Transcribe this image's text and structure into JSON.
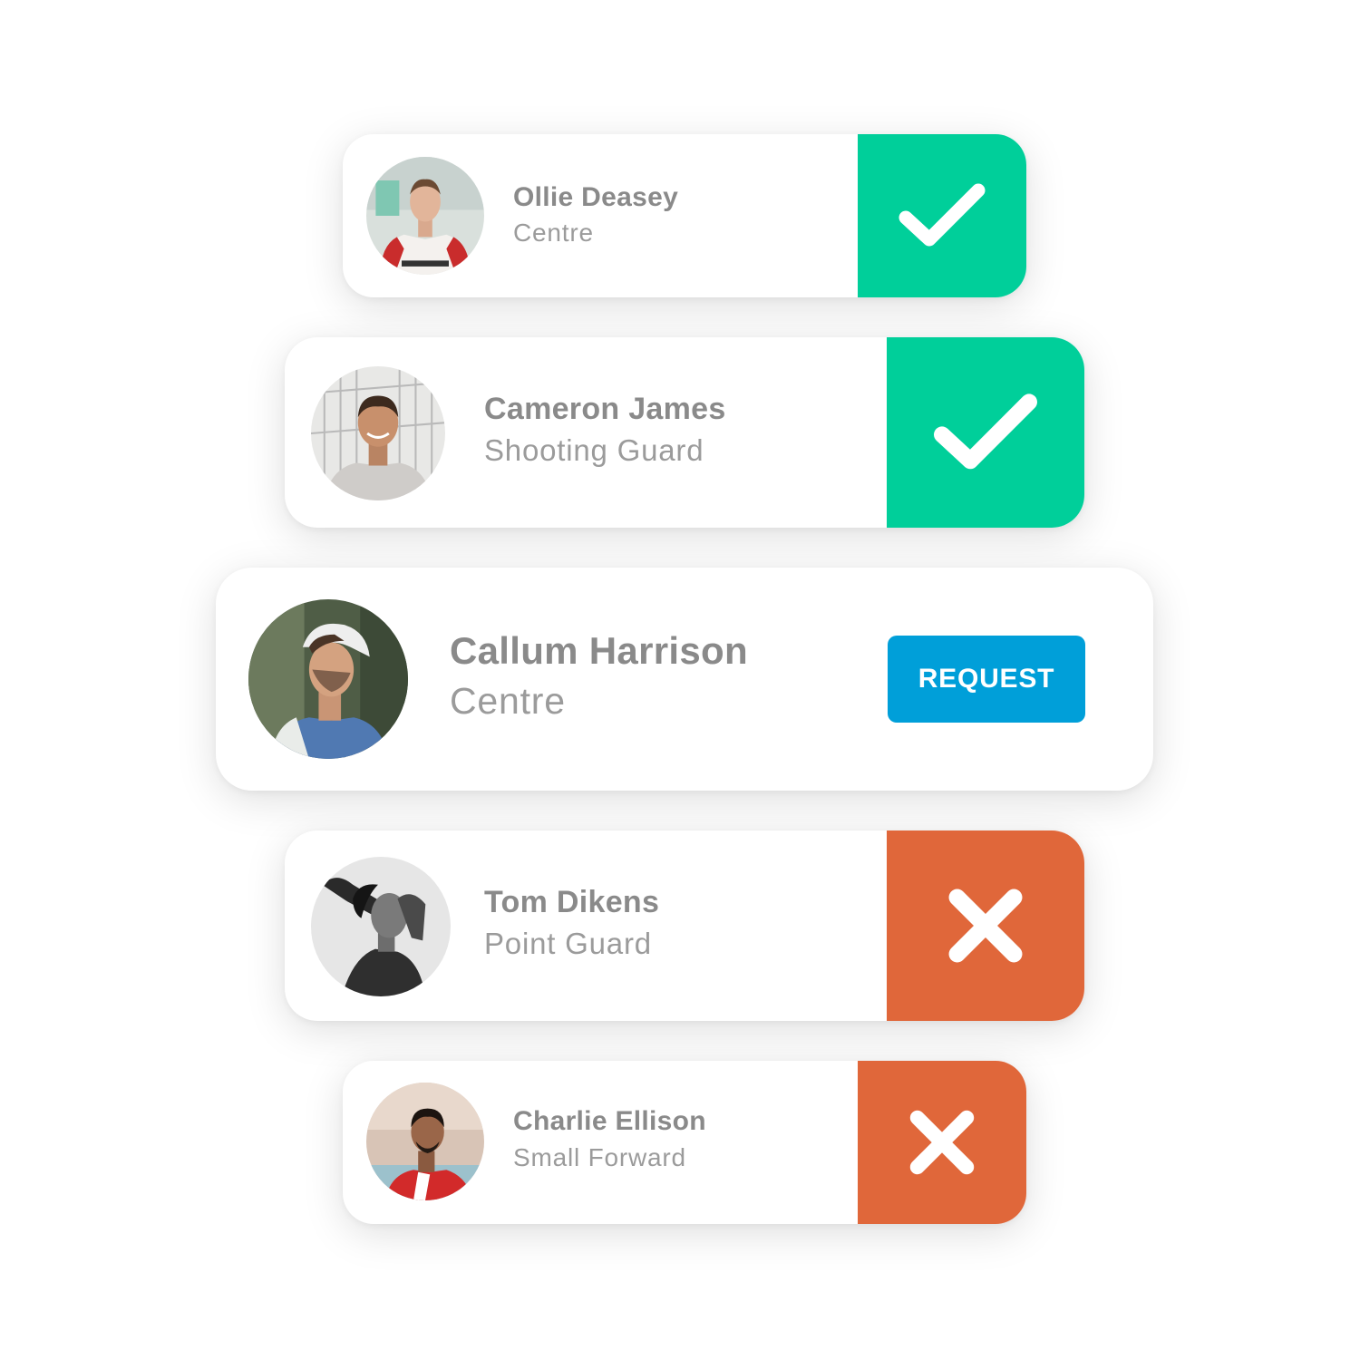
{
  "colors": {
    "accepted": "#00cf9a",
    "declined": "#e0673a",
    "request": "#009fd9",
    "name_text": "#8a8a8a",
    "role_text": "#9b9b9b"
  },
  "players": [
    {
      "name": "Ollie Deasey",
      "position": "Centre",
      "status": "accepted",
      "status_icon": "check-icon"
    },
    {
      "name": "Cameron James",
      "position": "Shooting Guard",
      "status": "accepted",
      "status_icon": "check-icon"
    },
    {
      "name": "Callum Harrison",
      "position": "Centre",
      "status": "pending",
      "request_label": "REQUEST"
    },
    {
      "name": "Tom Dikens",
      "position": "Point Guard",
      "status": "declined",
      "status_icon": "close-icon"
    },
    {
      "name": "Charlie Ellison",
      "position": "Small Forward",
      "status": "declined",
      "status_icon": "close-icon"
    }
  ]
}
